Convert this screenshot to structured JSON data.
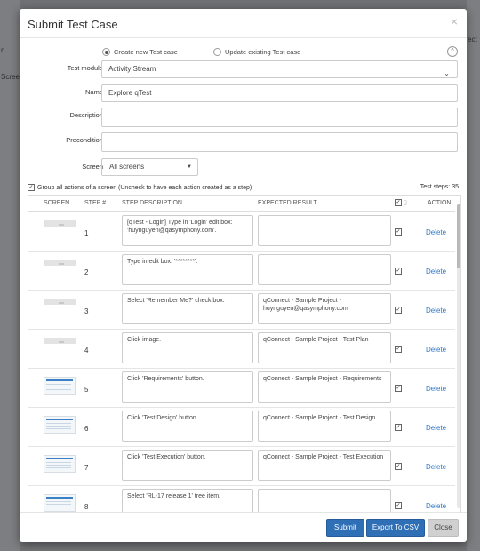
{
  "background": {
    "left_fragment": "n",
    "left_label": "Screen",
    "right_fragment": "ect"
  },
  "modal": {
    "title": "Submit Test Case",
    "close_glyph": "×",
    "radio_new": "Create new Test case",
    "radio_update": "Update existing Test case",
    "collapse_glyph": "^"
  },
  "form": {
    "test_module_label": "Test module",
    "test_module_value": "Activity Stream",
    "name_label": "Name",
    "name_value": "Explore qTest",
    "description_label": "Description",
    "description_value": "",
    "precondition_label": "Precondition",
    "precondition_value": "",
    "screen_label": "Screen",
    "screen_value": "All screens",
    "group_label": "Group all actions of a screen (Uncheck to have each action created as a step)",
    "test_steps": "Test steps: 35"
  },
  "table": {
    "headers": [
      "SCREEN",
      "STEP #",
      "STEP DESCRIPTION",
      "EXPECTED RESULT",
      "ACTION"
    ],
    "delete_label": "Delete",
    "rows": [
      {
        "step": "1",
        "desc": "[qTest - Login] Type  in 'Login' edit box: 'huynguyen@qasymphony.com'.",
        "expected": "",
        "thumb": "blank"
      },
      {
        "step": "2",
        "desc": "Type  in edit box: '********'.",
        "expected": "",
        "thumb": "blank"
      },
      {
        "step": "3",
        "desc": "Select 'Remember Me?' check box.",
        "expected": "qConnect - Sample Project - huynguyen@qasymphony.com",
        "thumb": "blank"
      },
      {
        "step": "4",
        "desc": "Click image.",
        "expected": "qConnect - Sample Project - Test Plan",
        "thumb": "blank"
      },
      {
        "step": "5",
        "desc": "Click 'Requirements' button.",
        "expected": "qConnect - Sample Project - Requirements",
        "thumb": "img"
      },
      {
        "step": "6",
        "desc": "Click 'Test Design' button.",
        "expected": "qConnect - Sample Project - Test Design",
        "thumb": "img"
      },
      {
        "step": "7",
        "desc": "Click 'Test Execution' button.",
        "expected": "qConnect - Sample Project - Test Execution",
        "thumb": "img"
      },
      {
        "step": "8",
        "desc": "Select 'RL-17 release 1' tree item.",
        "expected": "",
        "thumb": "img"
      }
    ]
  },
  "footer": {
    "submit": "Submit",
    "export": "Export To CSV",
    "close": "Close"
  },
  "colors": {
    "accent": "#2e6fb5",
    "link": "#2f78c5",
    "overlay": "#6f7174"
  }
}
